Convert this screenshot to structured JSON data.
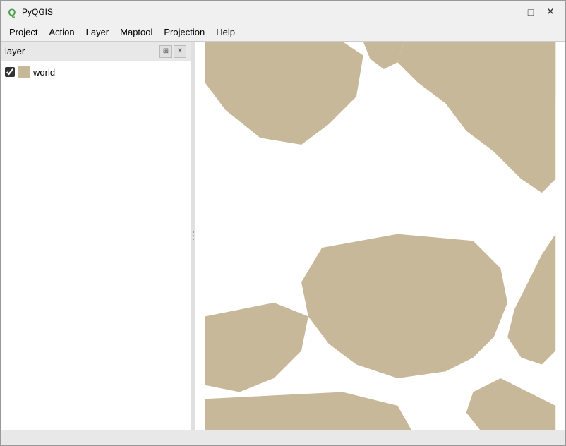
{
  "window": {
    "title": "PyQGIS",
    "minimize_label": "—",
    "maximize_label": "□",
    "close_label": "✕"
  },
  "menubar": {
    "items": [
      {
        "id": "project",
        "label": "Project"
      },
      {
        "id": "action",
        "label": "Action"
      },
      {
        "id": "layer",
        "label": "Layer"
      },
      {
        "id": "maptool",
        "label": "Maptool"
      },
      {
        "id": "projection",
        "label": "Projection"
      },
      {
        "id": "help",
        "label": "Help"
      }
    ]
  },
  "layer_panel": {
    "title": "layer",
    "layers": [
      {
        "id": "world",
        "name": "world",
        "visible": true,
        "color": "#c8b89a"
      }
    ]
  },
  "map": {
    "background": "#ffffff",
    "land_color": "#c8b89a",
    "water_color": "#ffffff"
  },
  "statusbar": {
    "text": ""
  }
}
